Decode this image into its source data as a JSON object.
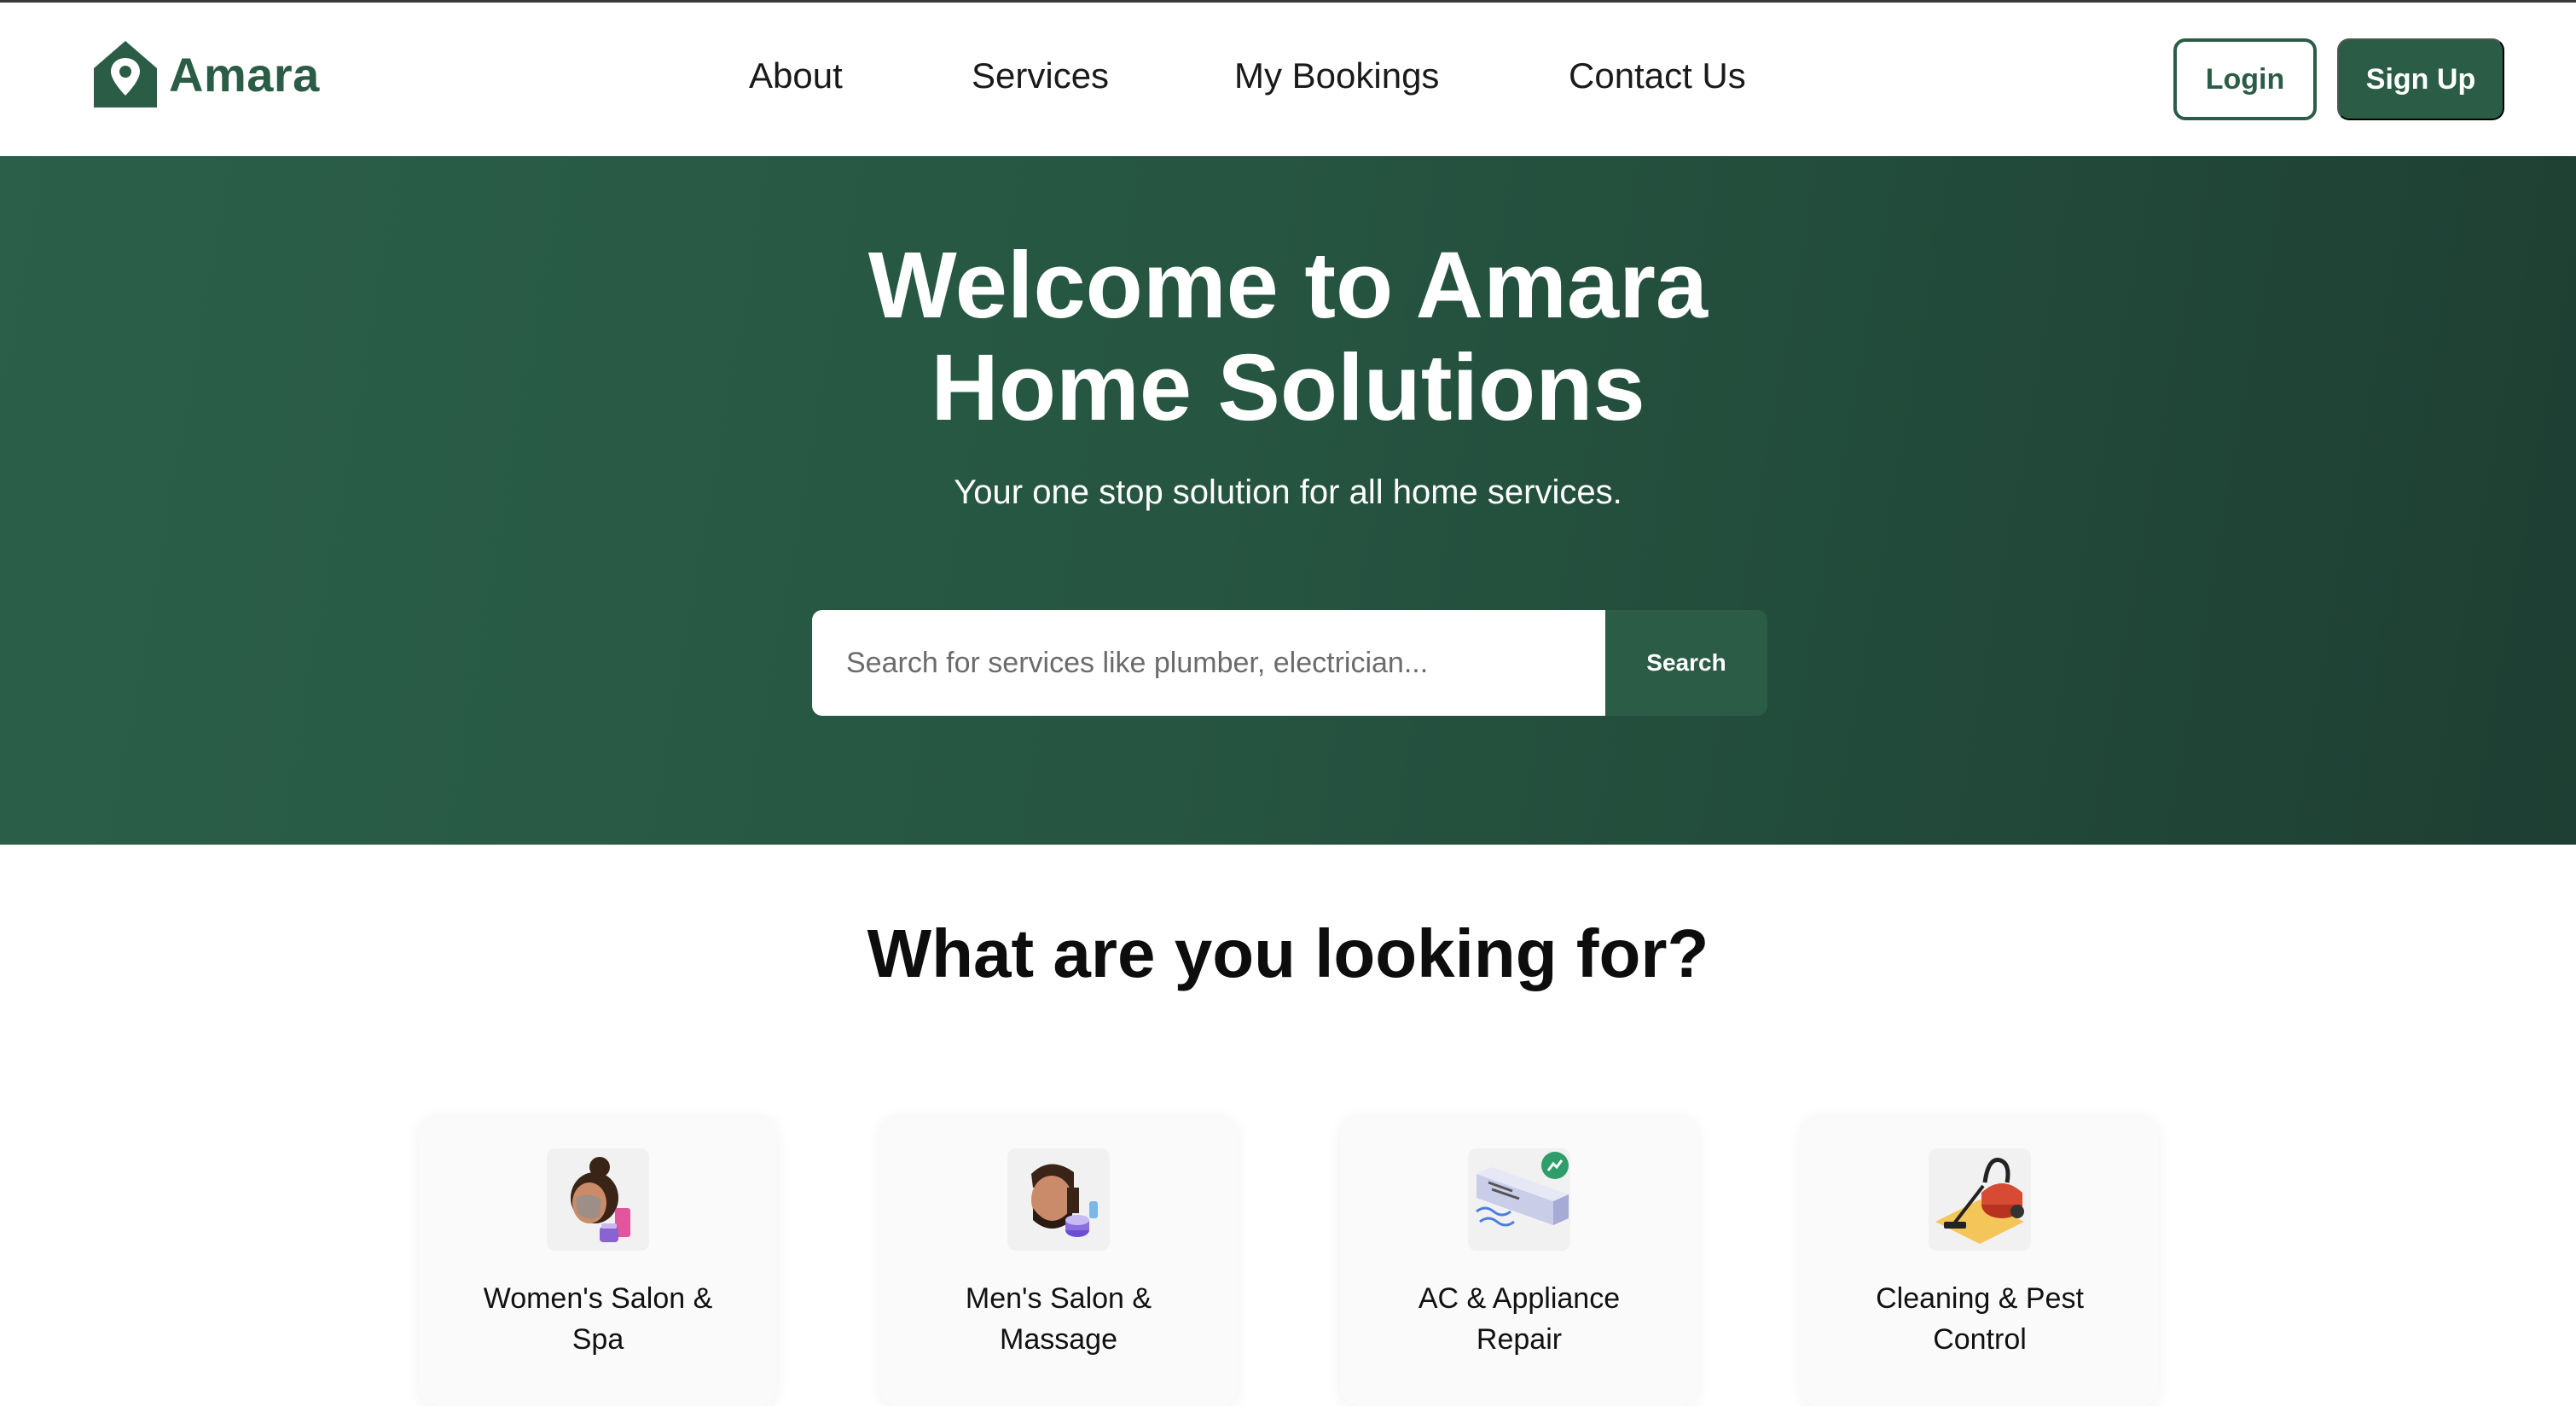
{
  "brand": {
    "name": "Amara",
    "color": "#2b5c46"
  },
  "nav": {
    "items": [
      {
        "label": "About"
      },
      {
        "label": "Services"
      },
      {
        "label": "My Bookings"
      },
      {
        "label": "Contact Us"
      }
    ],
    "login_label": "Login",
    "signup_label": "Sign Up"
  },
  "hero": {
    "title_line1": "Welcome to Amara",
    "title_line2": "Home Solutions",
    "subtitle": "Your one stop solution for all home services.",
    "search_placeholder": "Search for services like plumber, electrician...",
    "search_button": "Search"
  },
  "categories": {
    "title": "What are you looking for?",
    "items": [
      {
        "line1": "Women's Salon &",
        "line2": "Spa",
        "icon": "women-salon-icon"
      },
      {
        "line1": "Men's Salon &",
        "line2": "Massage",
        "icon": "men-salon-icon"
      },
      {
        "line1": "AC & Appliance",
        "line2": "Repair",
        "icon": "ac-repair-icon"
      },
      {
        "line1": "Cleaning & Pest",
        "line2": "Control",
        "icon": "vacuum-cleaner-icon"
      }
    ]
  }
}
